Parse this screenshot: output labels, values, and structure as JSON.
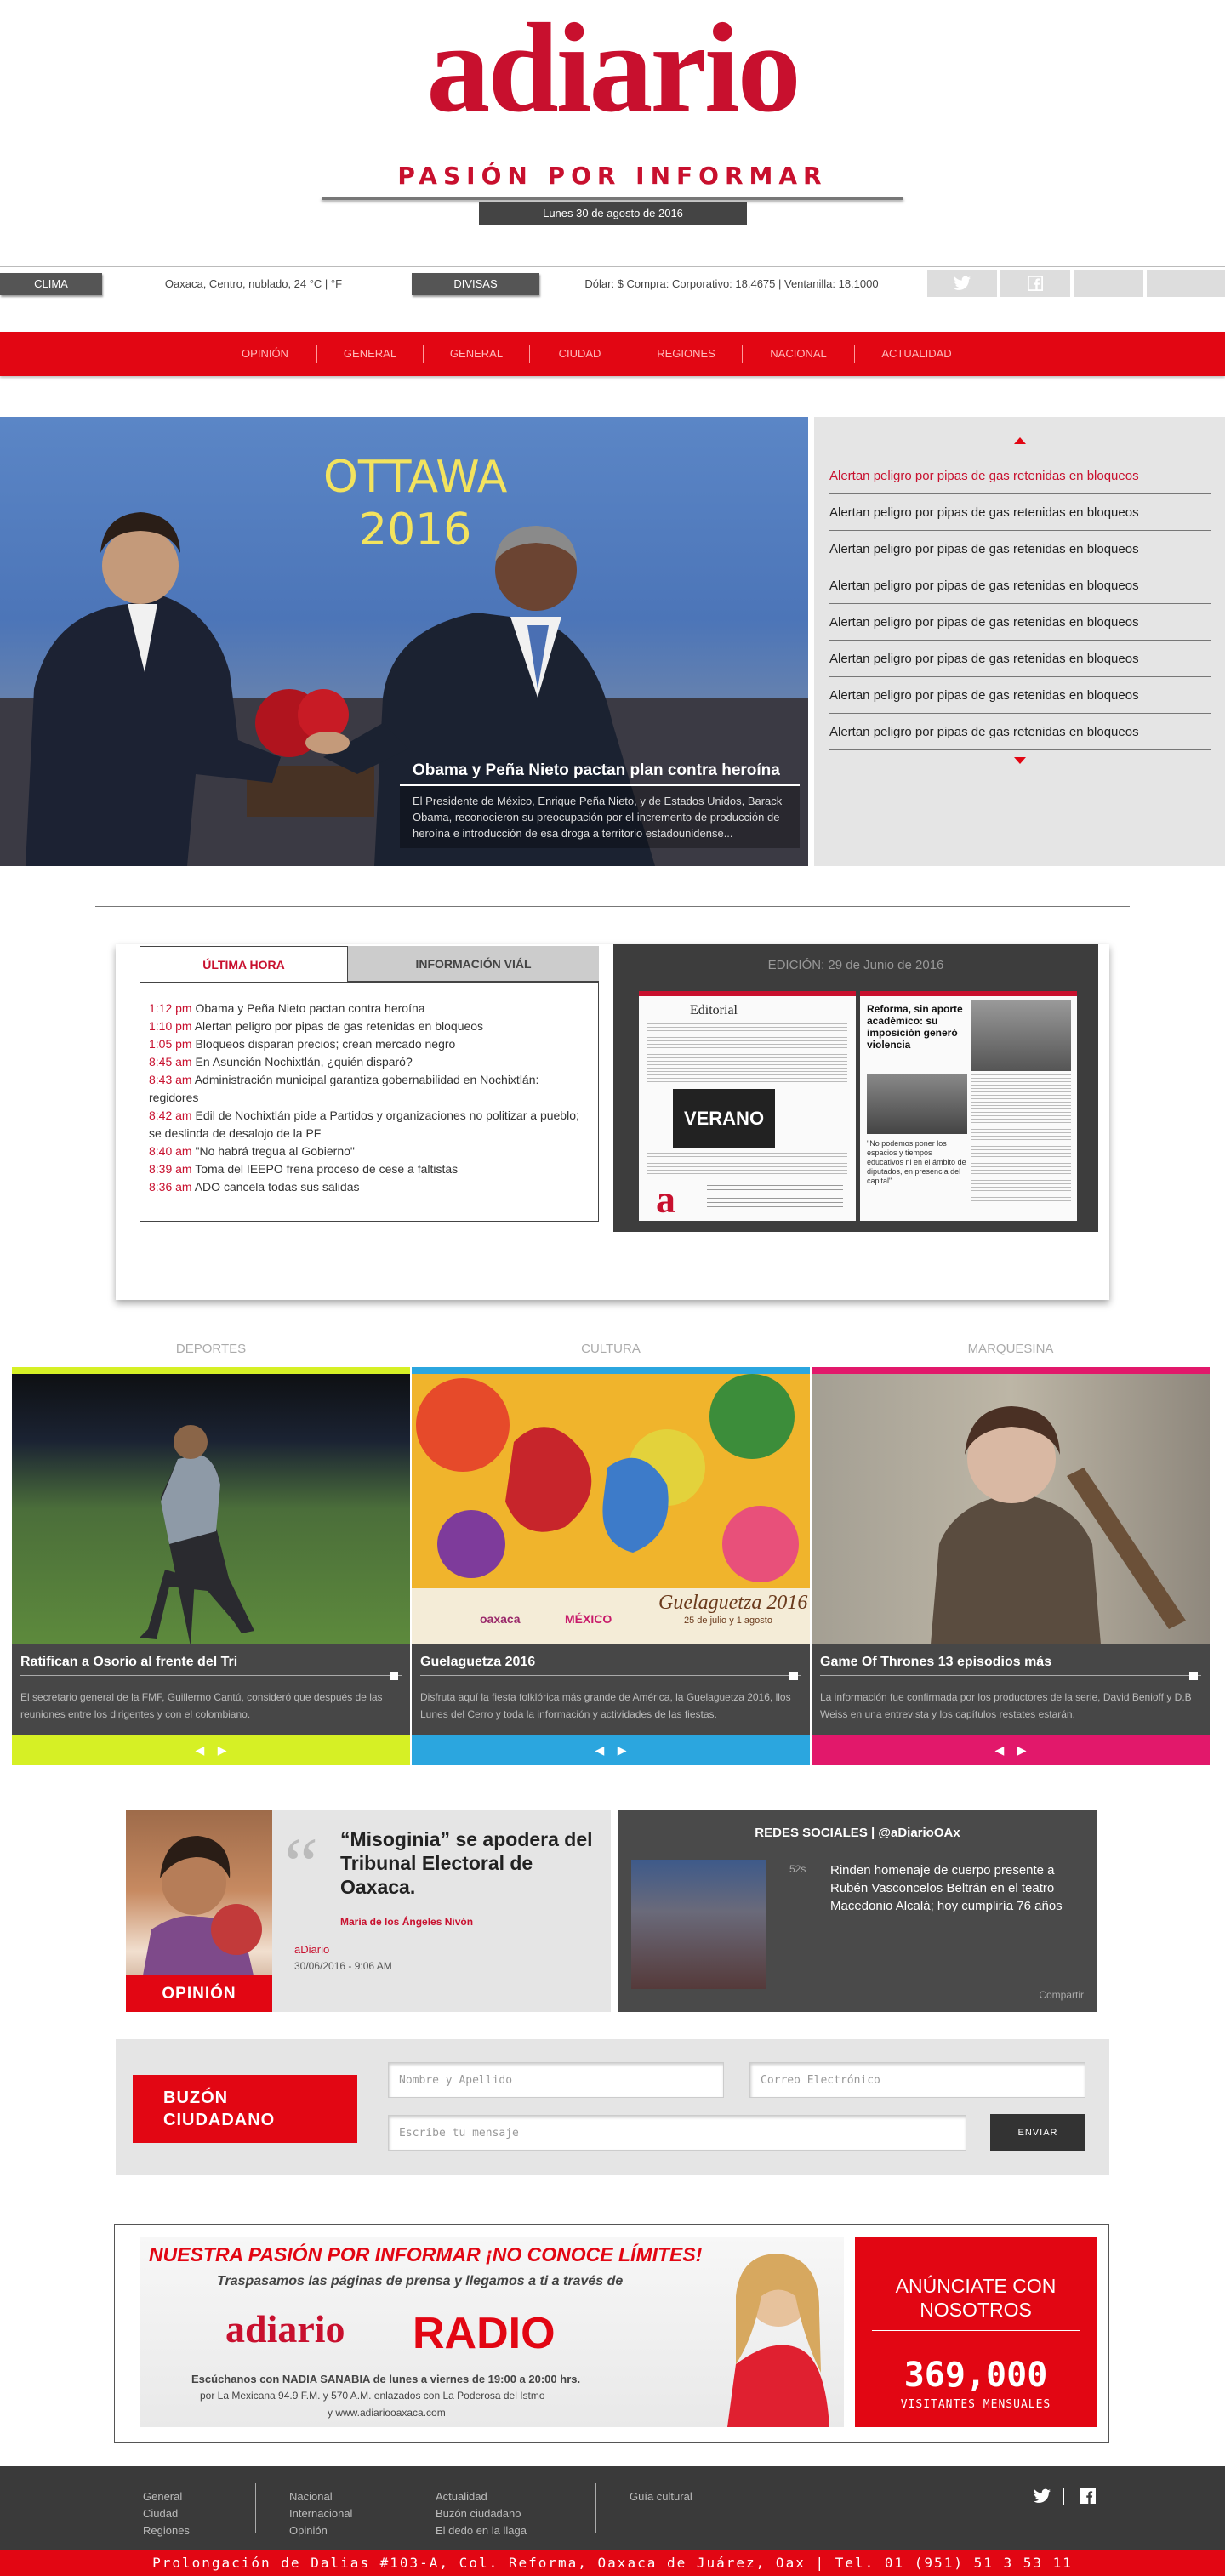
{
  "header": {
    "logo": "adiario",
    "tagline": "PASIÓN POR INFORMAR",
    "date": "Lunes 30 de agosto de 2016"
  },
  "infobar": {
    "clima_label": "CLIMA",
    "clima_value": "Oaxaca, Centro, nublado, 24 °C | °F",
    "divisas_label": "DIVISAS",
    "divisas_value": "Dólar: $ Compra: Corporativo: 18.4675 | Ventanilla: 18.1000",
    "social_icons": [
      "twitter-icon",
      "facebook-icon"
    ]
  },
  "nav": [
    "OPINIÓN",
    "GENERAL",
    "GENERAL",
    "CIUDAD",
    "REGIONES",
    "NACIONAL",
    "ACTUALIDAD"
  ],
  "hero": {
    "image_text": "OTTAWA\n2016",
    "title": "Obama y Peña Nieto pactan plan contra heroína",
    "desc": "El Presidente de México, Enrique Peña Nieto, y de Estados Unidos, Barack Obama, reconocieron su preocupación por el incremento de producción de heroína e introducción de esa droga a territorio estadounidense..."
  },
  "headlines": [
    "Alertan peligro por pipas de gas retenidas en bloqueos",
    "Alertan peligro por pipas de gas retenidas en bloqueos",
    "Alertan peligro por pipas de gas retenidas en bloqueos",
    "Alertan peligro por pipas de gas retenidas en bloqueos",
    "Alertan peligro por pipas de gas retenidas en bloqueos",
    "Alertan peligro por pipas de gas retenidas en bloqueos",
    "Alertan peligro por pipas de gas retenidas en bloqueos",
    "Alertan peligro por pipas de gas retenidas en bloqueos"
  ],
  "tabs": {
    "ultima": "ÚLTIMA HORA",
    "vial": "INFORMACIÓN VIÁL"
  },
  "ultima_hora": [
    {
      "time": "1:12 pm",
      "text": "Obama y Peña Nieto pactan contra heroína"
    },
    {
      "time": "1:10 pm",
      "text": "Alertan peligro por pipas de gas retenidas en bloqueos"
    },
    {
      "time": "1:05 pm",
      "text": "Bloqueos disparan precios; crean mercado negro"
    },
    {
      "time": "8:45 am",
      "text": "En Asunción Nochixtlán, ¿quién disparó?"
    },
    {
      "time": "8:43 am",
      "text": "Administración municipal garantiza gobernabilidad en Nochixtlán: regidores"
    },
    {
      "time": "8:42 am",
      "text": "Edil de Nochixtlán pide a Partidos y organizaciones no politizar a pueblo; se deslinda de desalojo de la PF"
    },
    {
      "time": "8:40 am",
      "text": "\"No habrá tregua al Gobierno\""
    },
    {
      "time": "8:39 am",
      "text": "Toma del IEEPO frena proceso de cese a faltistas"
    },
    {
      "time": "8:36 am",
      "text": "ADO cancela todas sus salidas"
    }
  ],
  "edition": {
    "title": "EDICIÓN: 29 de Junio de 2016",
    "left_page_head": "Editorial",
    "left_promo": "VERANO",
    "right_head": "Reforma, sin aporte académico: su imposición generó violencia",
    "right_pull": "\"No podemos poner los espacios y tiempos educativos ni en el ámbito de diputados, en presencia del capital\""
  },
  "categories": [
    {
      "label": "DEPORTES",
      "title": "Ratifican a Osorio al frente del Tri",
      "desc": "El secretario general de la FMF, Guillermo Cantú, consideró que después de las reuniones entre los dirigentes y con el colombiano.",
      "color": "#d6f025"
    },
    {
      "label": "CULTURA",
      "title": "Guelaguetza 2016",
      "desc": "Disfruta aquí la fiesta folklórica más grande de América, la Guelaguetza 2016, llos Lunes del Cerro y toda la información y actividades de las fiestas.",
      "color": "#2ba6df",
      "poster_title": "Guelaguetza 2016",
      "poster_sub": "25 de julio y 1 agosto",
      "poster_brand": "oaxaca",
      "poster_brand2": "MÉXICO"
    },
    {
      "label": "MARQUESINA",
      "title": "Game Of Thrones 13 episodios más",
      "desc": "La información fue confirmada por los productores de la serie, David Benioff y D.B Weiss en una entrevista y los capítulos restates estarán.",
      "color": "#e2186b"
    }
  ],
  "opinion": {
    "label": "OPINIÓN",
    "title": "“Misoginia” se apodera del Tribunal Electoral de Oaxaca.",
    "author": "María de los Ángeles Nivón",
    "source": "aDiario",
    "date": "30/06/2016 - 9:06 AM"
  },
  "redes": {
    "title": "REDES SOCIALES | @aDiarioOAx",
    "time": "52s",
    "text": "Rinden homenaje de cuerpo presente a Rubén Vasconcelos Beltrán en el teatro Macedonio Alcalá; hoy cumpliría 76 años",
    "share": "Compartir"
  },
  "buzon": {
    "label": "BUZÓN CIUDADANO",
    "name_ph": "Nombre y Apellido",
    "email_ph": "Correo Electrónico",
    "msg_ph": "Escribe tu mensaje",
    "send": "ENVIAR"
  },
  "ad": {
    "headline": "NUESTRA PASIÓN POR INFORMAR ¡NO CONOCE LÍMITES!",
    "sub": "Traspasamos las páginas de prensa y llegamos a ti a través de",
    "logo": "adiario",
    "radio": "RADIO",
    "line1": "Escúchanos con NADIA SANABIA de lunes a viernes de 19:00 a 20:00 hrs.",
    "line2": "por La Mexicana 94.9 F.M. y 570 A.M. enlazados con La Poderosa del Istmo",
    "url": "y www.adiariooaxaca.com",
    "cta": "ANÚNCIATE CON NOSOTROS",
    "count": "369,000",
    "count_lbl": "VISITANTES MENSUALES"
  },
  "footer": {
    "col1": [
      "General",
      "Ciudad",
      "Regiones"
    ],
    "col2": [
      "Nacional",
      "Internacional",
      "Opinión"
    ],
    "col3": [
      "Actualidad",
      "Buzón ciudadano",
      "El dedo en la llaga"
    ],
    "col4": [
      "Guía cultural"
    ],
    "address": "Prolongación de Dalias #103-A, Col. Reforma, Oaxaca de Juárez, Oax | Tel. 01 (951) 51 3 53 11"
  }
}
